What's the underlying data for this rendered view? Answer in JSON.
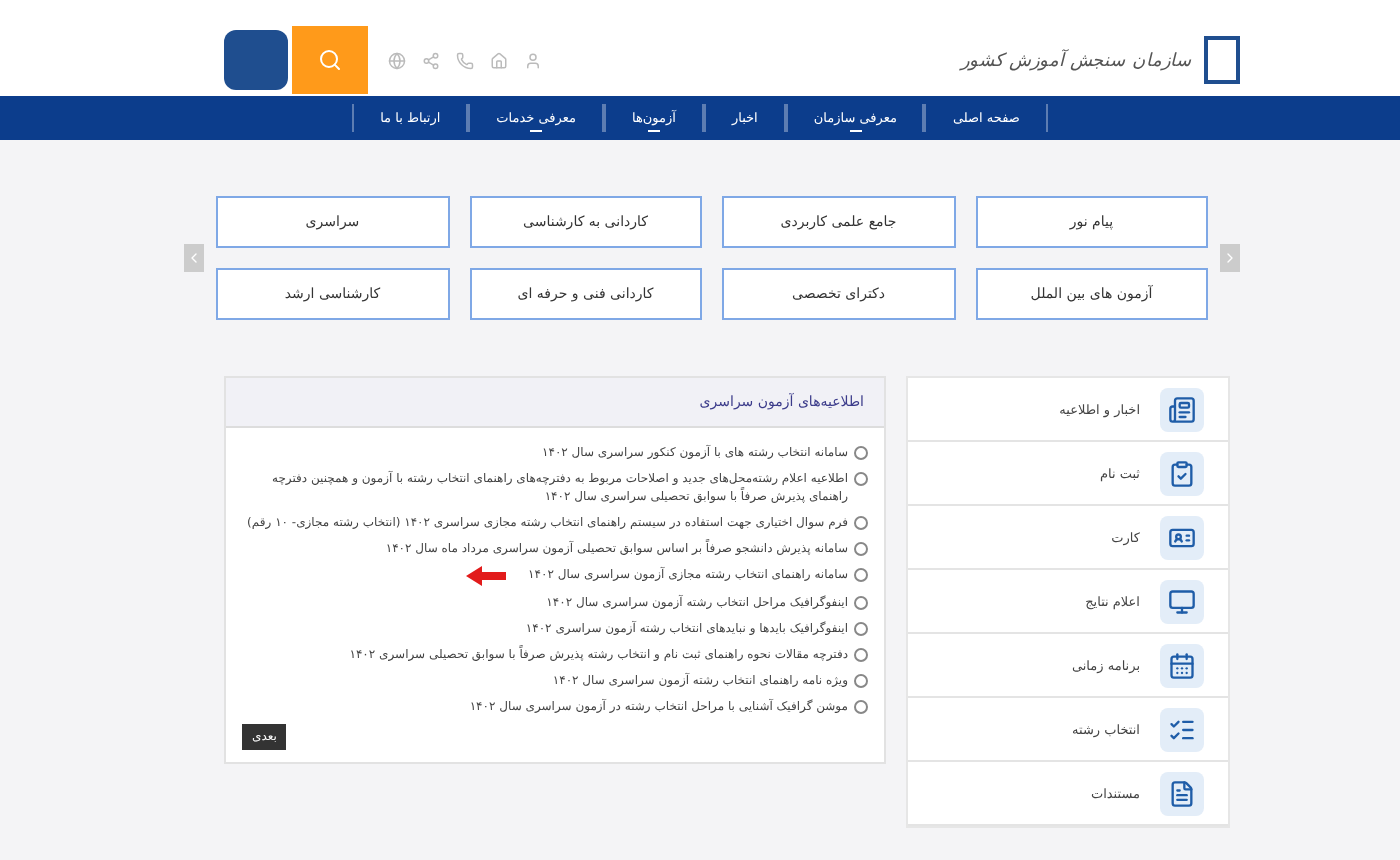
{
  "header": {
    "logo_text": "سازمان سنجش آموزش کشور",
    "nav": [
      {
        "label": "صفحه اصلی",
        "has_submenu": false
      },
      {
        "label": "معرفی سازمان",
        "has_submenu": true
      },
      {
        "label": "اخبار",
        "has_submenu": false
      },
      {
        "label": "آزمون‌ها",
        "has_submenu": true
      },
      {
        "label": "معرفی خدمات",
        "has_submenu": true
      },
      {
        "label": "ارتباط با ما",
        "has_submenu": false
      }
    ]
  },
  "categories": [
    "پیام نور",
    "جامع علمی کاربردی",
    "کاردانی به کارشناسی",
    "سراسری",
    "آزمون های بین الملل",
    "دکترای تخصصی",
    "کاردانی فنی و حرفه ای",
    "کارشناسی ارشد"
  ],
  "news": {
    "title": "اطلاعیه‌های آزمون سراسری",
    "items": [
      {
        "text": "سامانه انتخاب رشته های با آزمون کنکور سراسری سال ۱۴۰۲",
        "highlighted": false
      },
      {
        "text": "اطلاعیه اعلام رشته‌محل‌های جدید و اصلاحات مربوط به دفترچه‌های راهنمای انتخاب رشته با آزمون و همچنین دفترچه راهنمای پذیرش صرفاً با سوابق تحصیلی سراسری سال ۱۴۰۲",
        "highlighted": false
      },
      {
        "text": "فرم سوال اختیاری جهت استفاده در سیستم راهنمای انتخاب رشته مجازی سراسری ۱۴۰۲ (انتخاب رشته مجازی- ۱۰ رقم)",
        "highlighted": false
      },
      {
        "text": "سامانه پذیرش دانشجو صرفاً بر اساس سوابق تحصیلی آزمون سراسری مرداد ماه سال ۱۴۰۲",
        "highlighted": false
      },
      {
        "text": "سامانه راهنمای انتخاب رشته مجازی آزمون سراسری سال ۱۴۰۲",
        "highlighted": true
      },
      {
        "text": "اینفوگرافیک مراحل انتخاب رشته آزمون سراسری سال ۱۴۰۲",
        "highlighted": false
      },
      {
        "text": "اینفوگرافیک بایدها و نبایدهای انتخاب رشته آزمون سراسری ۱۴۰۲",
        "highlighted": false
      },
      {
        "text": "دفترچه مقالات نحوه راهنمای ثبت نام و انتخاب رشته پذیرش صرفاً با سوابق تحصیلی سراسری ۱۴۰۲",
        "highlighted": false
      },
      {
        "text": "ویژه نامه راهنمای انتخاب رشته آزمون سراسری سال ۱۴۰۲",
        "highlighted": false
      },
      {
        "text": "موشن گرافیک آشنایی با مراحل انتخاب رشته در آزمون سراسری سال ۱۴۰۲",
        "highlighted": false
      }
    ],
    "next_button": "بعدی"
  },
  "sidebar": [
    {
      "label": "اخبار و اطلاعیه",
      "kind": "news"
    },
    {
      "label": "ثبت نام",
      "kind": "register"
    },
    {
      "label": "کارت",
      "kind": "card"
    },
    {
      "label": "اعلام نتایج",
      "kind": "results"
    },
    {
      "label": "برنامه زمانی",
      "kind": "schedule"
    },
    {
      "label": "انتخاب رشته",
      "kind": "selection"
    },
    {
      "label": "مستندات",
      "kind": "documents"
    }
  ]
}
